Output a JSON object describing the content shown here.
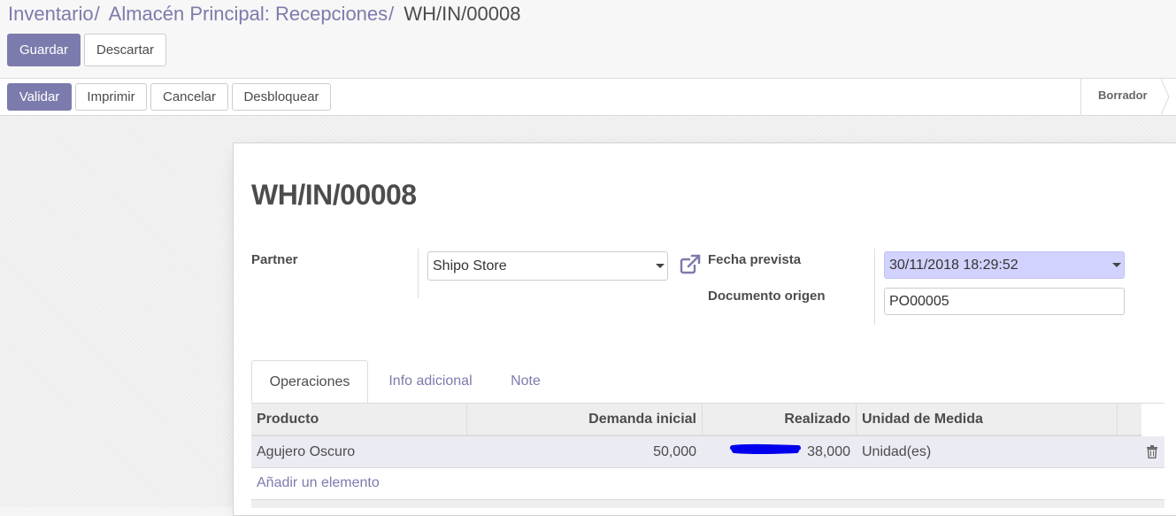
{
  "breadcrumb": {
    "items": [
      "Inventario",
      "Almacén Principal: Recepciones"
    ],
    "separator": "/",
    "current": "WH/IN/00008"
  },
  "toolbar": {
    "save_label": "Guardar",
    "discard_label": "Descartar"
  },
  "actions": {
    "validate_label": "Validar",
    "print_label": "Imprimir",
    "cancel_label": "Cancelar",
    "unlock_label": "Desbloquear"
  },
  "status": {
    "current": "Borrador"
  },
  "record": {
    "title": "WH/IN/00008",
    "partner_label": "Partner",
    "partner_value": "Shipo Store",
    "scheduled_label": "Fecha prevista",
    "scheduled_value": "30/11/2018 18:29:52",
    "origin_label": "Documento origen",
    "origin_value": "PO00005"
  },
  "tabs": [
    {
      "label": "Operaciones",
      "active": true
    },
    {
      "label": "Info adicional",
      "active": false
    },
    {
      "label": "Note",
      "active": false
    }
  ],
  "table": {
    "headers": [
      "Producto",
      "Demanda inicial",
      "Realizado",
      "Unidad de Medida"
    ],
    "rows": [
      {
        "product": "Agujero Oscuro",
        "demand": "50,000",
        "done": "38,000",
        "uom": "Unidad(es)"
      }
    ],
    "add_line_label": "Añadir un elemento"
  },
  "icons": {
    "external_link": "external-link-icon",
    "dropdown": "caret-down-icon",
    "delete": "trash-icon"
  },
  "colors": {
    "brand": "#7c7bad",
    "highlight_field": "#d2d2ff",
    "row_highlight": "#ebebf3",
    "annotation_stroke": "#0000ee"
  }
}
